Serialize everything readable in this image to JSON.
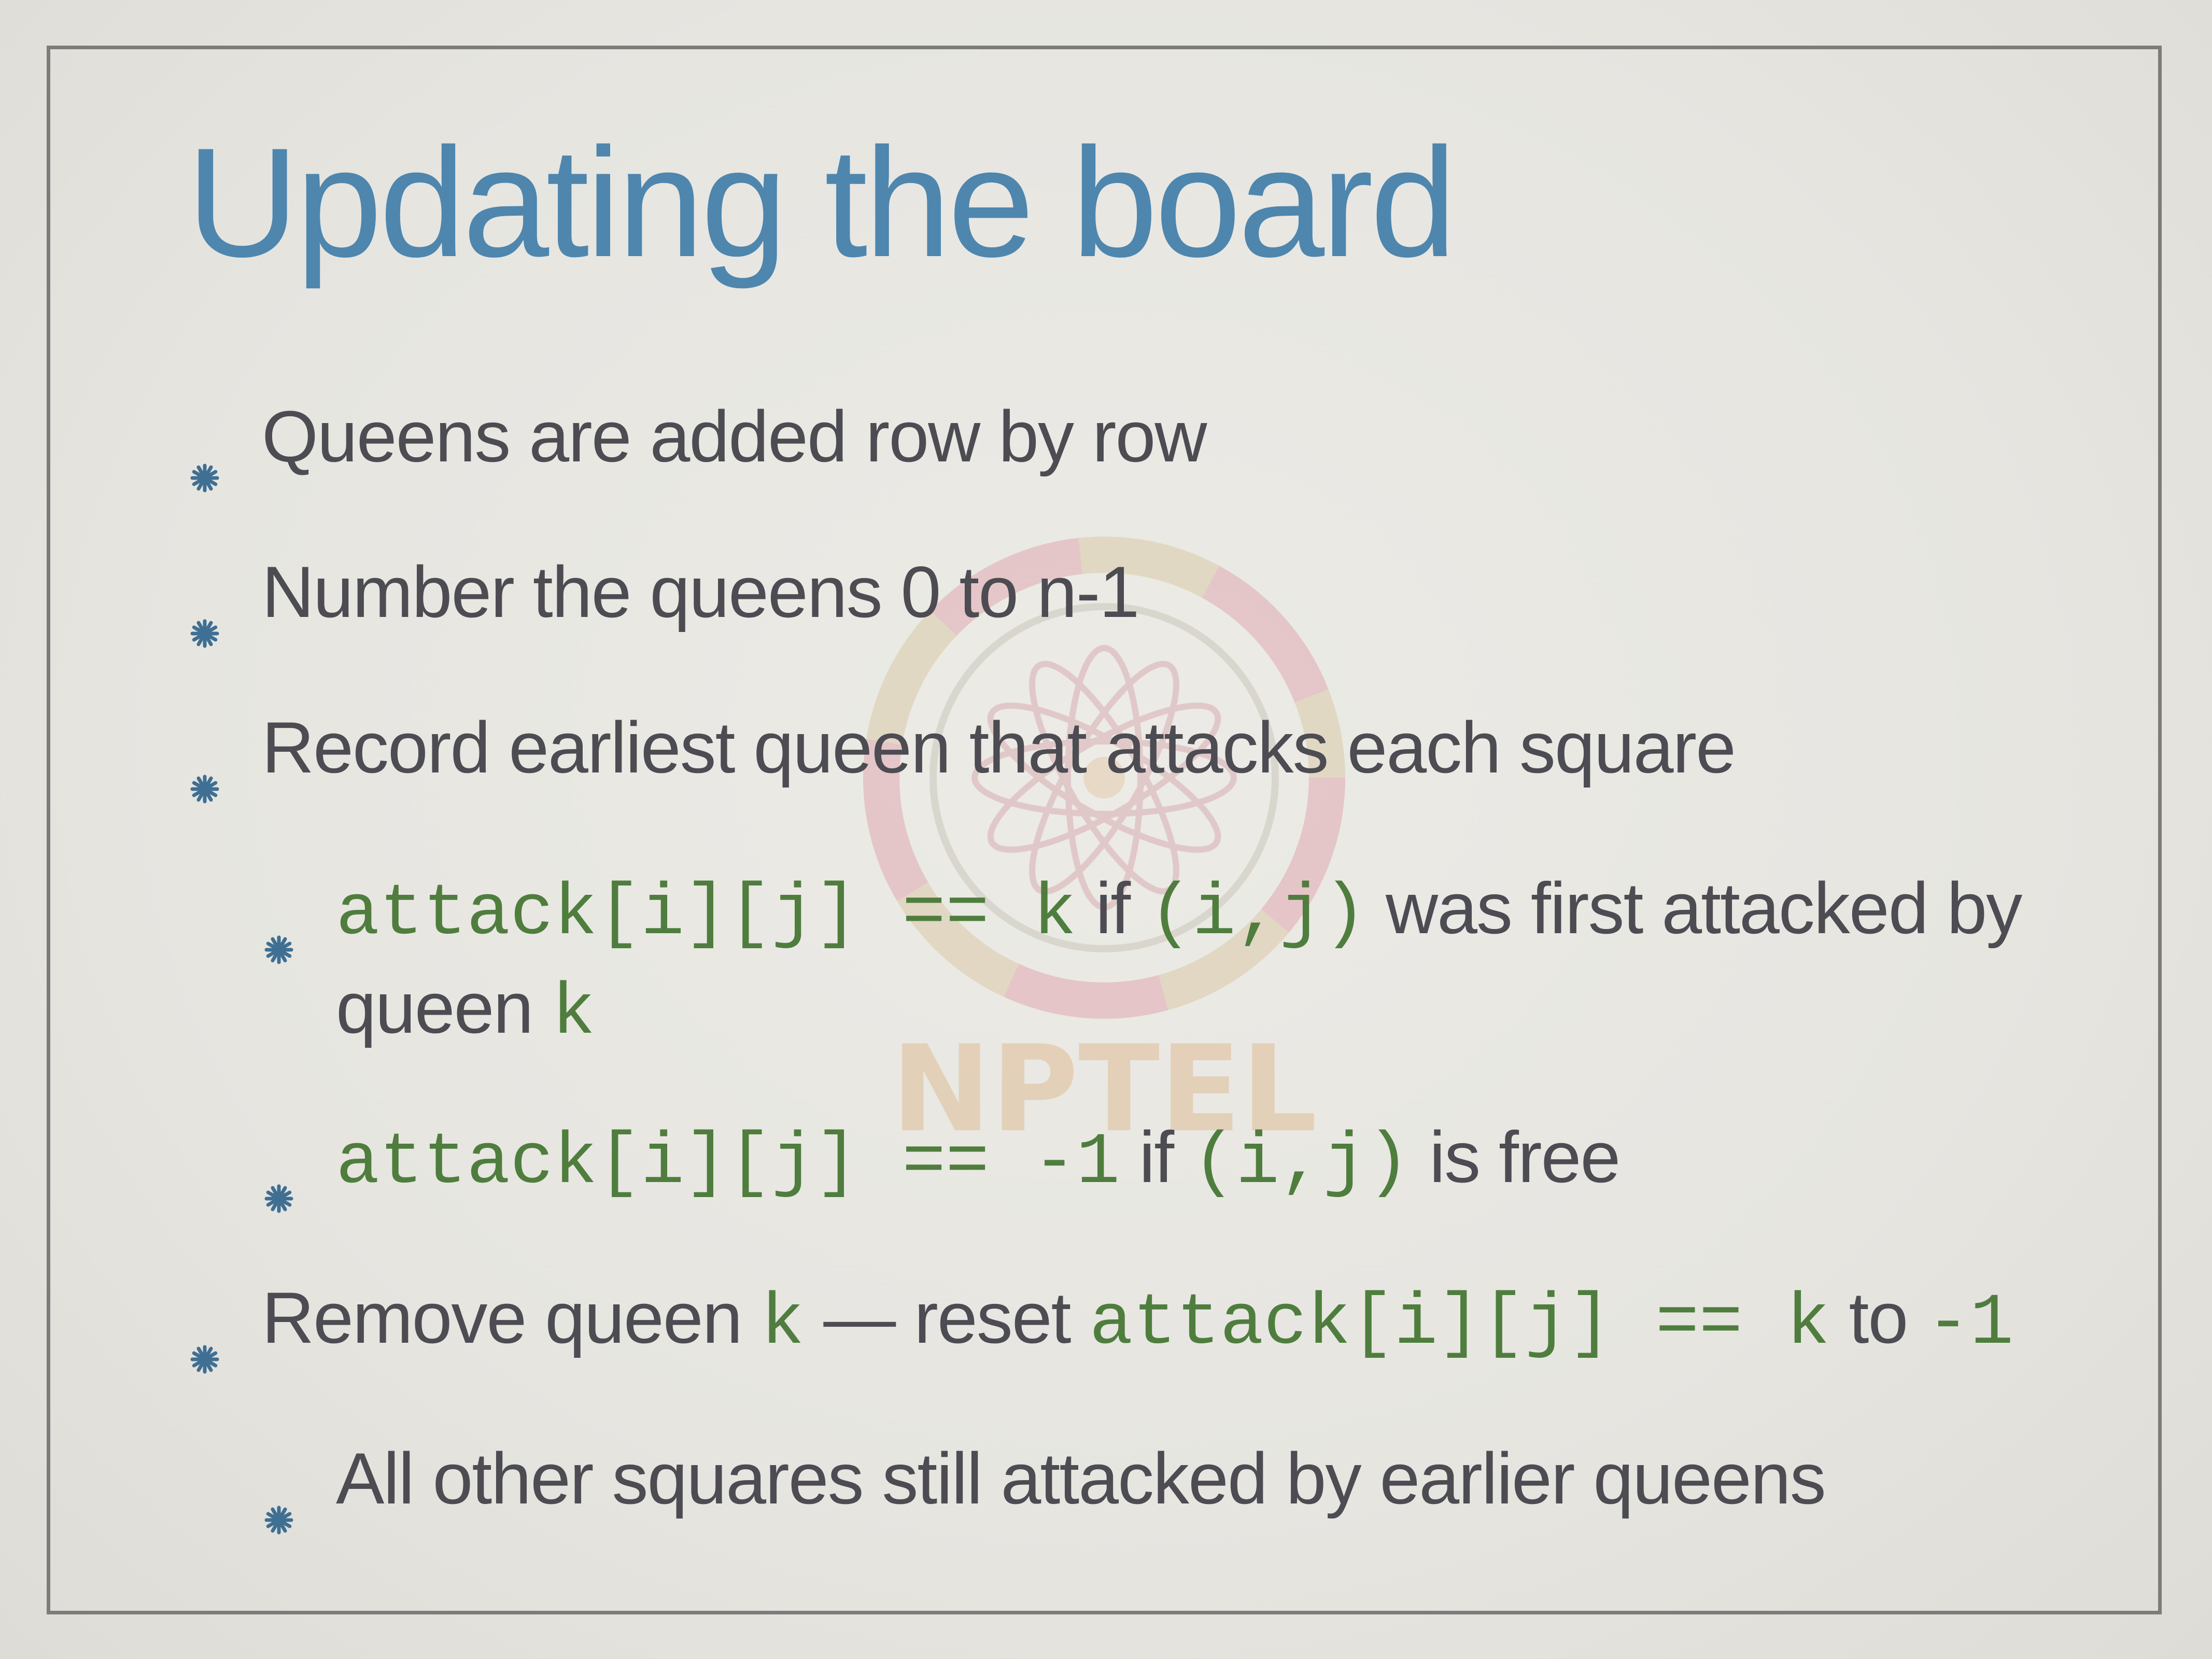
{
  "slide": {
    "title": "Updating the board",
    "watermark_text": "NPTEL",
    "bullets": [
      {
        "level": 1,
        "parts": [
          {
            "type": "text",
            "value": "Queens are added row by row"
          }
        ]
      },
      {
        "level": 1,
        "parts": [
          {
            "type": "text",
            "value": "Number the queens 0 to n-1"
          }
        ]
      },
      {
        "level": 1,
        "parts": [
          {
            "type": "text",
            "value": "Record earliest queen that attacks each square"
          }
        ]
      },
      {
        "level": 2,
        "parts": [
          {
            "type": "code",
            "value": "attack[i][j] == k"
          },
          {
            "type": "text",
            "value": " if "
          },
          {
            "type": "code",
            "value": "(i,j)"
          },
          {
            "type": "text",
            "value": " was first attacked by"
          }
        ],
        "continuation": [
          {
            "type": "text",
            "value": "queen "
          },
          {
            "type": "code",
            "value": "k"
          }
        ]
      },
      {
        "level": 2,
        "parts": [
          {
            "type": "code",
            "value": "attack[i][j] == -1"
          },
          {
            "type": "text",
            "value": " if "
          },
          {
            "type": "code",
            "value": "(i,j)"
          },
          {
            "type": "text",
            "value": " is free"
          }
        ]
      },
      {
        "level": 1,
        "parts": [
          {
            "type": "text",
            "value": "Remove queen "
          },
          {
            "type": "code",
            "value": "k"
          },
          {
            "type": "text",
            "value": " — reset "
          },
          {
            "type": "code",
            "value": "attack[i][j] == k"
          },
          {
            "type": "text",
            "value": " to "
          },
          {
            "type": "code",
            "value": "-1"
          }
        ]
      },
      {
        "level": 2,
        "parts": [
          {
            "type": "text",
            "value": "All other squares still attacked by earlier queens"
          }
        ]
      }
    ]
  },
  "colors": {
    "title": "#4e86ae",
    "body_text": "#4c4c52",
    "code_text": "#4f7d3e",
    "bullet_star": "#3f6f93",
    "frame": "#7c7c7a"
  },
  "icons": {
    "bullet": "asterisk-bullet-icon",
    "watermark": "nptel-logo-icon"
  }
}
